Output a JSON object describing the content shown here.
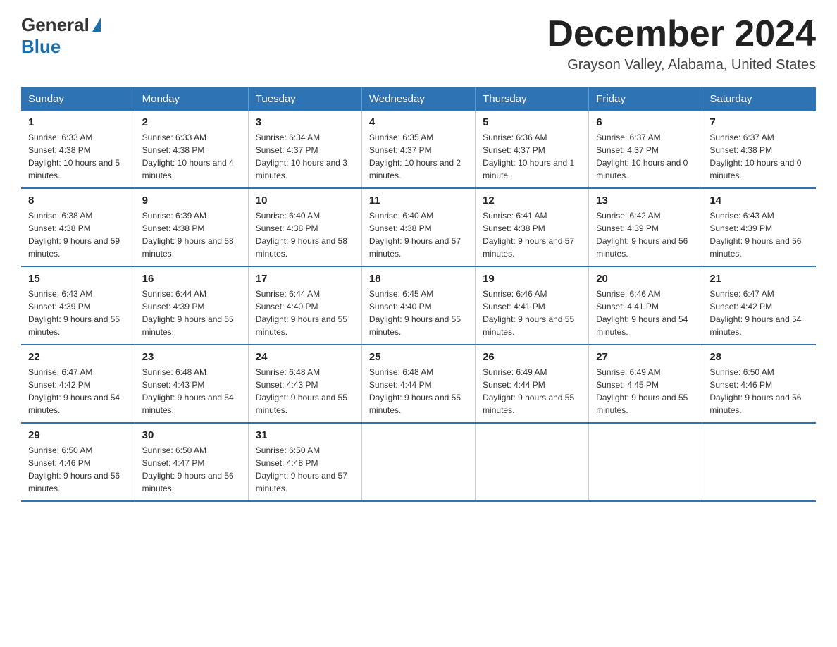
{
  "header": {
    "logo": {
      "general": "General",
      "blue": "Blue"
    },
    "title": "December 2024",
    "location": "Grayson Valley, Alabama, United States"
  },
  "days_of_week": [
    "Sunday",
    "Monday",
    "Tuesday",
    "Wednesday",
    "Thursday",
    "Friday",
    "Saturday"
  ],
  "weeks": [
    [
      {
        "day": "1",
        "sunrise": "6:33 AM",
        "sunset": "4:38 PM",
        "daylight": "10 hours and 5 minutes."
      },
      {
        "day": "2",
        "sunrise": "6:33 AM",
        "sunset": "4:38 PM",
        "daylight": "10 hours and 4 minutes."
      },
      {
        "day": "3",
        "sunrise": "6:34 AM",
        "sunset": "4:37 PM",
        "daylight": "10 hours and 3 minutes."
      },
      {
        "day": "4",
        "sunrise": "6:35 AM",
        "sunset": "4:37 PM",
        "daylight": "10 hours and 2 minutes."
      },
      {
        "day": "5",
        "sunrise": "6:36 AM",
        "sunset": "4:37 PM",
        "daylight": "10 hours and 1 minute."
      },
      {
        "day": "6",
        "sunrise": "6:37 AM",
        "sunset": "4:37 PM",
        "daylight": "10 hours and 0 minutes."
      },
      {
        "day": "7",
        "sunrise": "6:37 AM",
        "sunset": "4:38 PM",
        "daylight": "10 hours and 0 minutes."
      }
    ],
    [
      {
        "day": "8",
        "sunrise": "6:38 AM",
        "sunset": "4:38 PM",
        "daylight": "9 hours and 59 minutes."
      },
      {
        "day": "9",
        "sunrise": "6:39 AM",
        "sunset": "4:38 PM",
        "daylight": "9 hours and 58 minutes."
      },
      {
        "day": "10",
        "sunrise": "6:40 AM",
        "sunset": "4:38 PM",
        "daylight": "9 hours and 58 minutes."
      },
      {
        "day": "11",
        "sunrise": "6:40 AM",
        "sunset": "4:38 PM",
        "daylight": "9 hours and 57 minutes."
      },
      {
        "day": "12",
        "sunrise": "6:41 AM",
        "sunset": "4:38 PM",
        "daylight": "9 hours and 57 minutes."
      },
      {
        "day": "13",
        "sunrise": "6:42 AM",
        "sunset": "4:39 PM",
        "daylight": "9 hours and 56 minutes."
      },
      {
        "day": "14",
        "sunrise": "6:43 AM",
        "sunset": "4:39 PM",
        "daylight": "9 hours and 56 minutes."
      }
    ],
    [
      {
        "day": "15",
        "sunrise": "6:43 AM",
        "sunset": "4:39 PM",
        "daylight": "9 hours and 55 minutes."
      },
      {
        "day": "16",
        "sunrise": "6:44 AM",
        "sunset": "4:39 PM",
        "daylight": "9 hours and 55 minutes."
      },
      {
        "day": "17",
        "sunrise": "6:44 AM",
        "sunset": "4:40 PM",
        "daylight": "9 hours and 55 minutes."
      },
      {
        "day": "18",
        "sunrise": "6:45 AM",
        "sunset": "4:40 PM",
        "daylight": "9 hours and 55 minutes."
      },
      {
        "day": "19",
        "sunrise": "6:46 AM",
        "sunset": "4:41 PM",
        "daylight": "9 hours and 55 minutes."
      },
      {
        "day": "20",
        "sunrise": "6:46 AM",
        "sunset": "4:41 PM",
        "daylight": "9 hours and 54 minutes."
      },
      {
        "day": "21",
        "sunrise": "6:47 AM",
        "sunset": "4:42 PM",
        "daylight": "9 hours and 54 minutes."
      }
    ],
    [
      {
        "day": "22",
        "sunrise": "6:47 AM",
        "sunset": "4:42 PM",
        "daylight": "9 hours and 54 minutes."
      },
      {
        "day": "23",
        "sunrise": "6:48 AM",
        "sunset": "4:43 PM",
        "daylight": "9 hours and 54 minutes."
      },
      {
        "day": "24",
        "sunrise": "6:48 AM",
        "sunset": "4:43 PM",
        "daylight": "9 hours and 55 minutes."
      },
      {
        "day": "25",
        "sunrise": "6:48 AM",
        "sunset": "4:44 PM",
        "daylight": "9 hours and 55 minutes."
      },
      {
        "day": "26",
        "sunrise": "6:49 AM",
        "sunset": "4:44 PM",
        "daylight": "9 hours and 55 minutes."
      },
      {
        "day": "27",
        "sunrise": "6:49 AM",
        "sunset": "4:45 PM",
        "daylight": "9 hours and 55 minutes."
      },
      {
        "day": "28",
        "sunrise": "6:50 AM",
        "sunset": "4:46 PM",
        "daylight": "9 hours and 56 minutes."
      }
    ],
    [
      {
        "day": "29",
        "sunrise": "6:50 AM",
        "sunset": "4:46 PM",
        "daylight": "9 hours and 56 minutes."
      },
      {
        "day": "30",
        "sunrise": "6:50 AM",
        "sunset": "4:47 PM",
        "daylight": "9 hours and 56 minutes."
      },
      {
        "day": "31",
        "sunrise": "6:50 AM",
        "sunset": "4:48 PM",
        "daylight": "9 hours and 57 minutes."
      },
      null,
      null,
      null,
      null
    ]
  ],
  "labels": {
    "sunrise": "Sunrise:",
    "sunset": "Sunset:",
    "daylight": "Daylight:"
  },
  "colors": {
    "header_bg": "#2e74b5",
    "border": "#2e74b5",
    "accent_blue": "#1a6fad"
  }
}
